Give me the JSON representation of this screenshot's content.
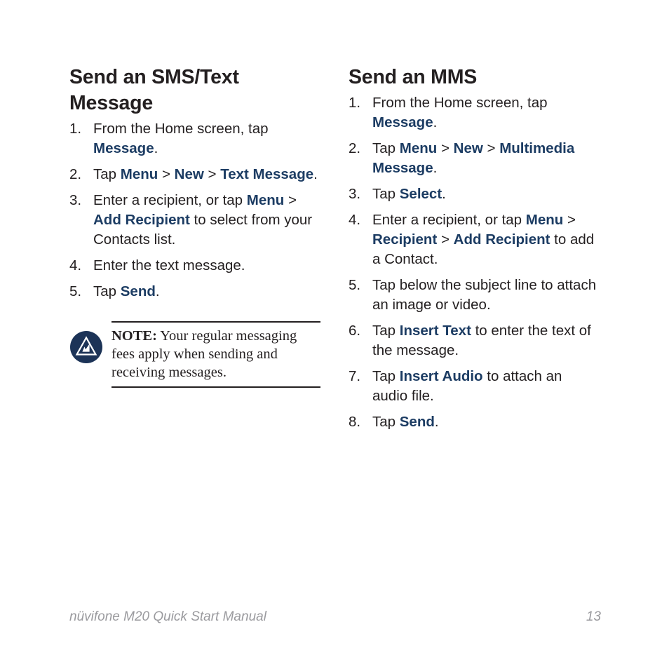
{
  "page": {
    "footer_title": "nüvifone M20 Quick Start Manual",
    "page_number": "13",
    "accent_color": "#1c3c63",
    "text_color": "#231f20",
    "footer_color": "#9a9a9e"
  },
  "left_column": {
    "heading": "Send an SMS/Text Message",
    "steps": [
      {
        "num": "1.",
        "parts": [
          {
            "text": "From the Home screen, tap ",
            "style": "normal"
          },
          {
            "text": "Message",
            "style": "bold-blue"
          },
          {
            "text": ".",
            "style": "normal"
          }
        ]
      },
      {
        "num": "2.",
        "parts": [
          {
            "text": "Tap ",
            "style": "normal"
          },
          {
            "text": "Menu",
            "style": "bold-blue"
          },
          {
            "text": " > ",
            "style": "normal"
          },
          {
            "text": "New",
            "style": "bold-blue"
          },
          {
            "text": " > ",
            "style": "normal"
          },
          {
            "text": "Text Message",
            "style": "bold-blue"
          },
          {
            "text": ".",
            "style": "normal"
          }
        ]
      },
      {
        "num": "3.",
        "parts": [
          {
            "text": "Enter a recipient, or tap ",
            "style": "normal"
          },
          {
            "text": "Menu",
            "style": "bold-blue"
          },
          {
            "text": " > ",
            "style": "normal"
          },
          {
            "text": "Add Recipient",
            "style": "bold-blue"
          },
          {
            "text": " to select from your Contacts list.",
            "style": "normal"
          }
        ]
      },
      {
        "num": "4.",
        "parts": [
          {
            "text": "Enter the text message.",
            "style": "normal"
          }
        ]
      },
      {
        "num": "5.",
        "parts": [
          {
            "text": "Tap ",
            "style": "normal"
          },
          {
            "text": "Send",
            "style": "bold-blue"
          },
          {
            "text": ".",
            "style": "normal"
          }
        ]
      }
    ],
    "note": {
      "icon": "garmin-triangle-logo-icon",
      "label": "NOTE:",
      "text": " Your regular messaging fees apply when sending and receiving messages."
    }
  },
  "right_column": {
    "heading": "Send an MMS",
    "steps": [
      {
        "num": "1.",
        "parts": [
          {
            "text": "From the Home screen, tap ",
            "style": "normal"
          },
          {
            "text": "Message",
            "style": "bold-blue"
          },
          {
            "text": ".",
            "style": "normal"
          }
        ]
      },
      {
        "num": "2.",
        "parts": [
          {
            "text": "Tap ",
            "style": "normal"
          },
          {
            "text": "Menu",
            "style": "bold-blue"
          },
          {
            "text": " > ",
            "style": "normal"
          },
          {
            "text": "New",
            "style": "bold-blue"
          },
          {
            "text": " > ",
            "style": "normal"
          },
          {
            "text": "Multimedia Message",
            "style": "bold-blue"
          },
          {
            "text": ".",
            "style": "normal"
          }
        ]
      },
      {
        "num": "3.",
        "parts": [
          {
            "text": "Tap ",
            "style": "normal"
          },
          {
            "text": "Select",
            "style": "bold-blue"
          },
          {
            "text": ".",
            "style": "normal"
          }
        ]
      },
      {
        "num": "4.",
        "parts": [
          {
            "text": "Enter a recipient, or tap ",
            "style": "normal"
          },
          {
            "text": "Menu",
            "style": "bold-blue"
          },
          {
            "text": " > ",
            "style": "normal"
          },
          {
            "text": "Recipient",
            "style": "bold-blue"
          },
          {
            "text": " > ",
            "style": "normal"
          },
          {
            "text": "Add Recipient",
            "style": "bold-blue"
          },
          {
            "text": " to add a Contact.",
            "style": "normal"
          }
        ]
      },
      {
        "num": "5.",
        "parts": [
          {
            "text": "Tap below the subject line to attach an image or video.",
            "style": "normal"
          }
        ]
      },
      {
        "num": "6.",
        "parts": [
          {
            "text": "Tap ",
            "style": "normal"
          },
          {
            "text": "Insert Text",
            "style": "bold-blue"
          },
          {
            "text": " to enter the text of the message.",
            "style": "normal"
          }
        ]
      },
      {
        "num": "7.",
        "parts": [
          {
            "text": "Tap ",
            "style": "normal"
          },
          {
            "text": "Insert Audio",
            "style": "bold-blue"
          },
          {
            "text": " to attach an audio file.",
            "style": "normal"
          }
        ]
      },
      {
        "num": "8.",
        "parts": [
          {
            "text": "Tap ",
            "style": "normal"
          },
          {
            "text": "Send",
            "style": "bold-blue"
          },
          {
            "text": ".",
            "style": "normal"
          }
        ]
      }
    ]
  }
}
